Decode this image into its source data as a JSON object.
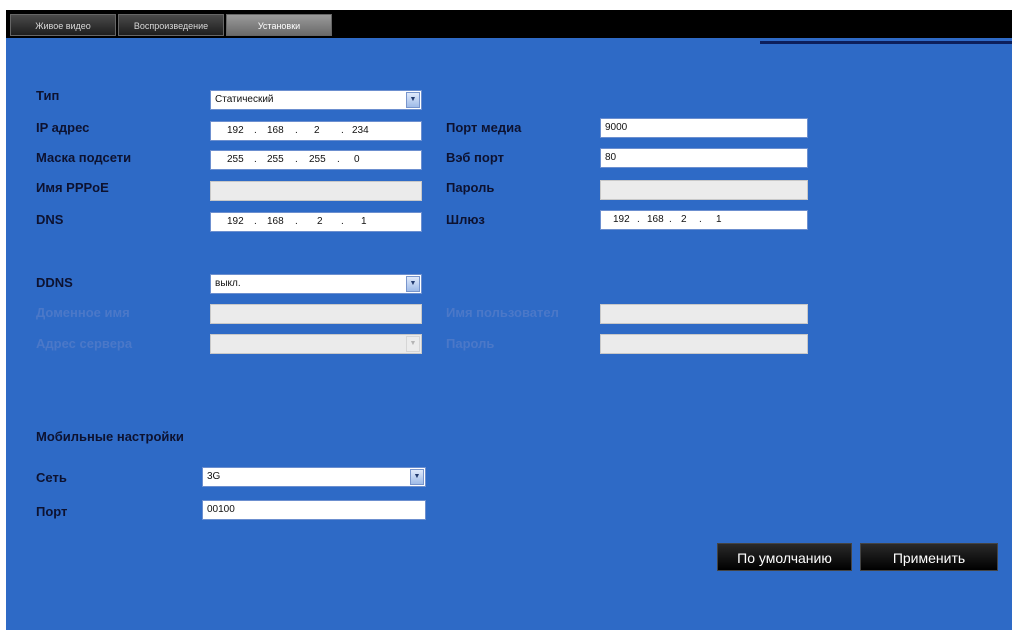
{
  "tabs": [
    {
      "label": "Живое видео"
    },
    {
      "label": "Воспроизведение"
    },
    {
      "label": "Установки"
    }
  ],
  "network": {
    "type_label": "Тип",
    "type_value": "Статический",
    "ip_label": "IP адрес",
    "ip": [
      "192",
      "168",
      "2",
      "234"
    ],
    "mask_label": "Маска подсети",
    "mask": [
      "255",
      "255",
      "255",
      "0"
    ],
    "pppoe_label": "Имя PPPoE",
    "pppoe_value": "",
    "dns_label": "DNS",
    "dns": [
      "192",
      "168",
      "2",
      "1"
    ],
    "media_port_label": "Порт медиа",
    "media_port_value": "9000",
    "web_port_label": "Вэб порт",
    "web_port_value": "80",
    "password_label": "Пароль",
    "password_value": "",
    "gateway_label": "Шлюз",
    "gateway": [
      "192",
      "168",
      "2",
      "1"
    ]
  },
  "ddns": {
    "label": "DDNS",
    "value": "выкл.",
    "domain_label": "Доменное имя",
    "domain_value": "",
    "server_label": "Адрес сервера",
    "server_value": "",
    "user_label": "Имя пользовател",
    "user_value": "",
    "password_label": "Пароль",
    "password_value": ""
  },
  "mobile": {
    "title": "Мобильные настройки",
    "network_label": "Сеть",
    "network_value": "3G",
    "port_label": "Порт",
    "port_value": "00100"
  },
  "buttons": {
    "default_label": "По умолчанию",
    "apply_label": "Применить"
  },
  "colors": {
    "background": "#2e6ac6",
    "topbar": "#000000",
    "label": "#0d1230"
  }
}
